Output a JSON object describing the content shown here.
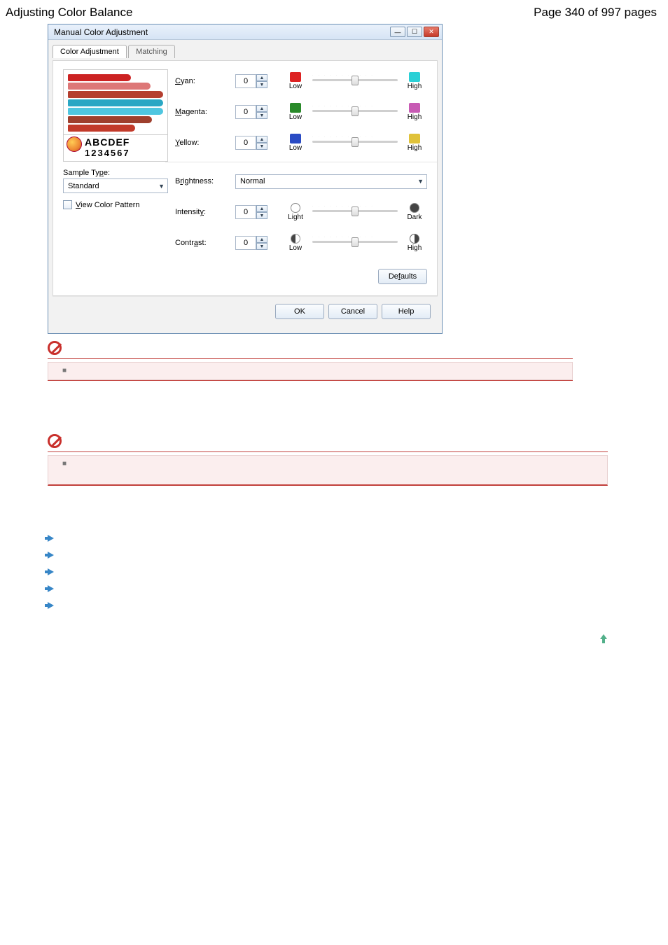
{
  "header": {
    "title": "Adjusting Color Balance",
    "page_indicator": "Page 340 of 997 pages"
  },
  "dialog": {
    "title": "Manual Color Adjustment",
    "tabs": {
      "active": "Color Adjustment",
      "inactive": "Matching"
    },
    "preview_text": {
      "line1": "ABCDEF",
      "line2": "1234567"
    },
    "sample_type": {
      "label": "Sample Type:",
      "value": "Standard"
    },
    "view_pattern_label": "View Color Pattern",
    "sliders": {
      "cyan": {
        "label": "Cyan:",
        "value": "0",
        "low": "Low",
        "high": "High"
      },
      "magenta": {
        "label": "Magenta:",
        "value": "0",
        "low": "Low",
        "high": "High"
      },
      "yellow": {
        "label": "Yellow:",
        "value": "0",
        "low": "Low",
        "high": "High"
      },
      "intensity": {
        "label": "Intensity:",
        "value": "0",
        "low": "Light",
        "high": "Dark"
      },
      "contrast": {
        "label": "Contrast:",
        "value": "0",
        "low": "Low",
        "high": "High"
      }
    },
    "brightness": {
      "label": "Brightness:",
      "value": "Normal"
    },
    "buttons": {
      "defaults": "Defaults",
      "ok": "OK",
      "cancel": "Cancel",
      "help": "Help"
    }
  },
  "notes": {
    "bullet": "■"
  }
}
